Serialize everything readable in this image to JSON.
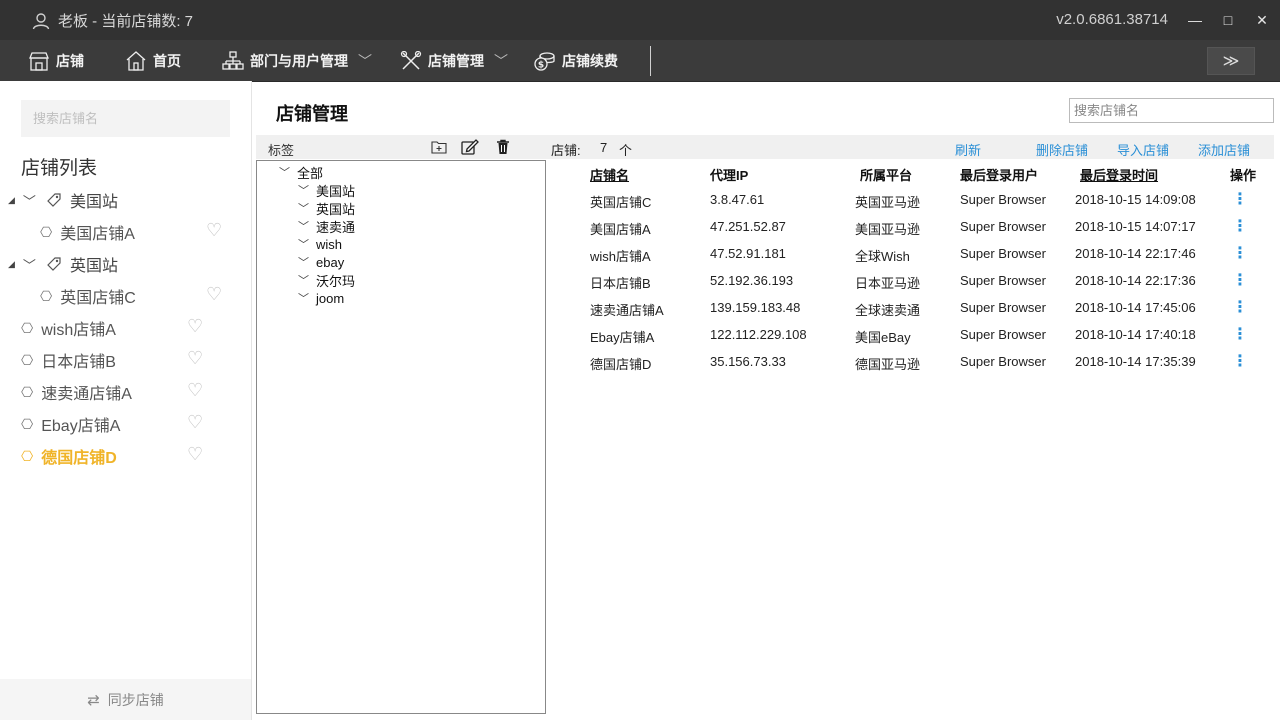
{
  "titlebar": {
    "user_text": "老板 - 当前店铺数: 7",
    "version": "v2.0.6861.38714",
    "minimize": "—",
    "maximize": "□",
    "close": "✕"
  },
  "nav": {
    "items": [
      {
        "label": "店铺",
        "icon": "store-icon"
      },
      {
        "label": "首页",
        "icon": "home-icon"
      },
      {
        "label": "部门与用户管理",
        "icon": "org-icon",
        "caret": "﹀"
      },
      {
        "label": "店铺管理",
        "icon": "tools-icon",
        "caret": "﹀"
      },
      {
        "label": "店铺续费",
        "icon": "money-icon"
      }
    ],
    "expand": "≫"
  },
  "sidebar": {
    "search_placeholder": "搜索店铺名",
    "title": "店铺列表",
    "groups": [
      {
        "label": "美国站",
        "children": [
          "美国店铺A"
        ]
      },
      {
        "label": "英国站",
        "children": [
          "英国店铺C"
        ]
      }
    ],
    "items": [
      "wish店铺A",
      "日本店铺B",
      "速卖通店铺A",
      "Ebay店铺A",
      "德国店铺D"
    ],
    "active_item": "德国店铺D",
    "active_color": "#f0b429",
    "sync_label": "同步店铺",
    "sync_icon": "⇄"
  },
  "main": {
    "title": "店铺管理",
    "search_placeholder": "搜索店铺名",
    "tag_label": "标签",
    "count_label": "店铺:",
    "count_value": "7",
    "count_unit": "个",
    "actions": [
      "刷新",
      "删除店铺",
      "导入店铺",
      "添加店铺"
    ],
    "link_color": "#2a8fd6"
  },
  "tags": {
    "root": "全部",
    "children": [
      "美国站",
      "英国站",
      "速卖通",
      "wish",
      "ebay",
      "沃尔玛",
      "joom"
    ]
  },
  "table": {
    "headers": [
      "店铺名",
      "代理IP",
      "所属平台",
      "最后登录用户",
      "最后登录时间",
      "操作"
    ],
    "rows": [
      [
        "英国店铺C",
        "3.8.47.61",
        "英国亚马逊",
        "Super Browser",
        "2018-10-15 14:09:08"
      ],
      [
        "美国店铺A",
        "47.251.52.87",
        "美国亚马逊",
        "Super Browser",
        "2018-10-15 14:07:17"
      ],
      [
        "wish店铺A",
        "47.52.91.181",
        "全球Wish",
        "Super Browser",
        "2018-10-14 22:17:46"
      ],
      [
        "日本店铺B",
        "52.192.36.193",
        "日本亚马逊",
        "Super Browser",
        "2018-10-14 22:17:36"
      ],
      [
        "速卖通店铺A",
        "139.159.183.48",
        "全球速卖通",
        "Super Browser",
        "2018-10-14 17:45:06"
      ],
      [
        "Ebay店铺A",
        "122.112.229.108",
        "美国eBay",
        "Super Browser",
        "2018-10-14 17:40:18"
      ],
      [
        "德国店铺D",
        "35.156.73.33",
        "德国亚马逊",
        "Super Browser",
        "2018-10-14 17:35:39"
      ]
    ],
    "op_glyph": "⋮"
  }
}
